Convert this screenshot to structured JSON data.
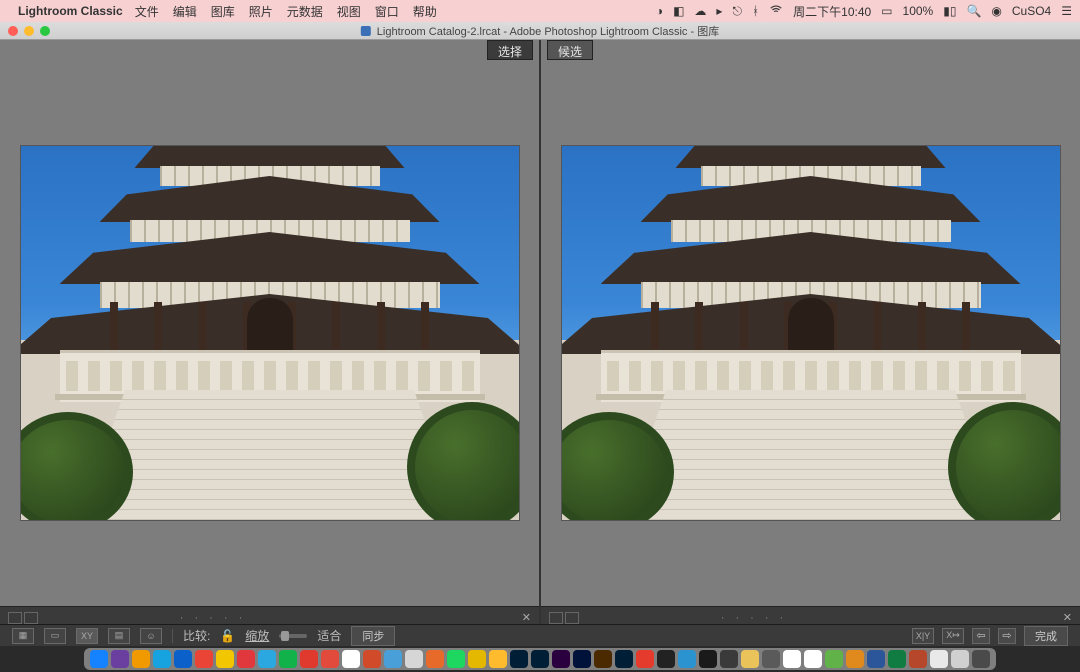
{
  "menubar": {
    "app_name": "Lightroom Classic",
    "items": [
      "文件",
      "编辑",
      "图库",
      "照片",
      "元数据",
      "视图",
      "窗口",
      "帮助"
    ],
    "right": {
      "day_time": "周二下午10:40",
      "battery": "100%",
      "user": "CuSO4"
    }
  },
  "window": {
    "title": "Lightroom Catalog-2.lrcat - Adobe Photoshop Lightroom Classic - 图库"
  },
  "panels": {
    "left_label": "选择",
    "right_label": "候选"
  },
  "toolbar": {
    "compare_label": "比较:",
    "zoom_label": "缩放",
    "fit_label": "适合",
    "sync_label": "同步",
    "done_label": "完成"
  },
  "colors": {
    "menubar_bg": "#f7d0d2",
    "panel_bg": "#7d7d7d",
    "toolbar_bg": "#3a3a3a"
  },
  "dock_colors": [
    "#1583ff",
    "#6b3fa0",
    "#f09a00",
    "#17a3e0",
    "#0b61c9",
    "#e94435",
    "#f2c600",
    "#e1383e",
    "#2ca8e0",
    "#11b24a",
    "#e03a2f",
    "#e24a3b",
    "#ffffff",
    "#d14b2a",
    "#49a0d8",
    "#d6d6d6",
    "#e86a2a",
    "#1ed760",
    "#e5b800",
    "#fdbb2d",
    "#001e36",
    "#001e36",
    "#2a003f",
    "#00123a",
    "#4b2a00",
    "#001e36",
    "#e43b2c",
    "#222222",
    "#2b94d0",
    "#1a1a1a",
    "#3a3a3a",
    "#eac35a",
    "#5a5a5a",
    "#ffffff",
    "#ffffff",
    "#62b24a",
    "#e08a1e",
    "#2b579a",
    "#107c41",
    "#b7472a",
    "#e9e9e9",
    "#d0d0d0",
    "#4a4a4a"
  ]
}
